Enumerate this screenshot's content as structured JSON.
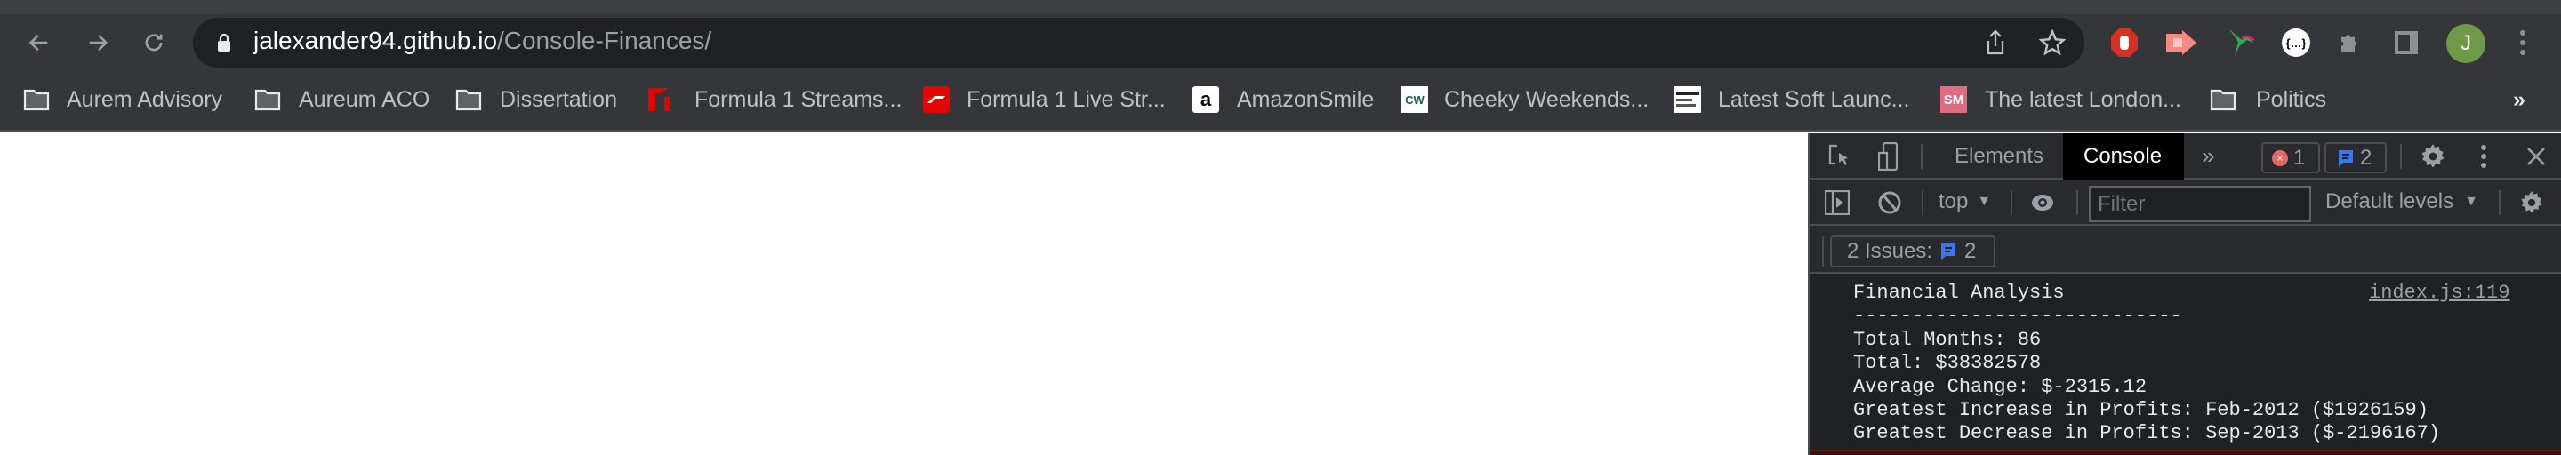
{
  "browser": {
    "url_host": "jalexander94.github.io",
    "url_path": "/Console-Finances/",
    "profile_initial": "J",
    "bookmarks": [
      {
        "label": "Aurem Advisory",
        "icon": "folder-icon"
      },
      {
        "label": "Aureum ACO",
        "icon": "folder-icon"
      },
      {
        "label": "Dissertation",
        "icon": "folder-icon"
      },
      {
        "label": "Formula 1 Streams...",
        "icon": "f1-favicon"
      },
      {
        "label": "Formula 1 Live Str...",
        "icon": "f1-live-favicon"
      },
      {
        "label": "AmazonSmile",
        "icon": "amazon-favicon"
      },
      {
        "label": "Cheeky Weekends...",
        "icon": "cw-favicon"
      },
      {
        "label": "Latest Soft Launc...",
        "icon": "soft-launch-favicon"
      },
      {
        "label": "The latest London...",
        "icon": "sm-favicon"
      },
      {
        "label": "Politics",
        "icon": "folder-icon"
      }
    ],
    "bookmark_favicon_text": {
      "cw": "CW",
      "sm": "SM",
      "amazon": "a"
    },
    "overflow": "»"
  },
  "devtools": {
    "tabs": {
      "elements": "Elements",
      "console": "Console",
      "more": "»"
    },
    "error_count": "1",
    "issue_count": "2",
    "context": "top",
    "filter_placeholder": "Filter",
    "levels": "Default levels",
    "issues_label": "2 Issues:",
    "issues_badge_count": "2",
    "console": {
      "source": "index.js:119",
      "lines": [
        "Financial Analysis",
        "----------------------------",
        "Total Months: 86",
        "Total: $38382578",
        "Average Change: $-2315.12",
        "Greatest Increase in Profits: Feb-2012 ($1926159)",
        "Greatest Decrease in Profits: Sep-2013 ($-2196167)"
      ]
    }
  },
  "colors": {
    "accent_blue": "#3b78e7",
    "error_red": "#e46962",
    "avatar_green": "#6e9a46"
  }
}
